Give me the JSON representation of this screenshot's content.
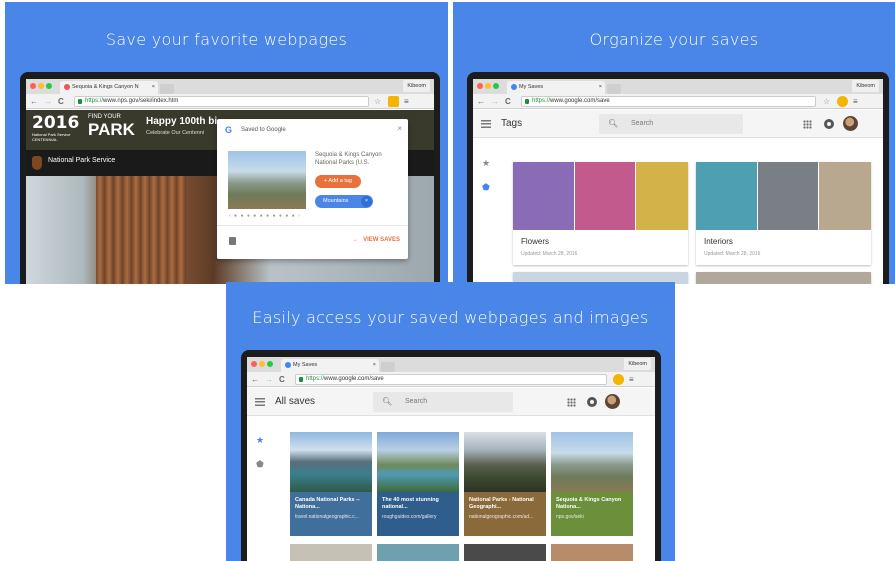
{
  "panels": {
    "p1": {
      "title": "Save your favorite webpages",
      "browser": {
        "tab_title": "Sequoia & Kings Canyon N",
        "tab_close": "×",
        "profile": "Kibeom",
        "url_scheme": "https://",
        "url_rest": "www.nps.gov/seki/index.htm"
      },
      "site": {
        "year": "2016",
        "logo_line1": "National Park Service",
        "logo_line2": "CENTENNIAL",
        "find_your": "FIND YOUR",
        "park": "PARK",
        "happy": "Happy 100th bi",
        "celebrate": "Celebrate Our Centenni",
        "bar_label": "National Park Service"
      },
      "popup": {
        "g_letter": "G",
        "saved_to": "Saved to Google",
        "close": "×",
        "page_title": "Sequoia & Kings Canyon National Parks (U.S.",
        "add_tag": "+ Add a tag",
        "tag": "Mountains",
        "tag_remove": "×",
        "pager": "‹ ● ● ● ● ● ● ● ● ● ● ›",
        "view_saves": "VIEW SAVES",
        "view_arrow": "→"
      }
    },
    "p2": {
      "title": "Organize your saves",
      "browser": {
        "tab_title": "My Saves",
        "tab_close": "×",
        "profile": "Kibeom",
        "url_scheme": "https://",
        "url_rest": "www.google.com/save"
      },
      "header": {
        "title": "Tags",
        "search_placeholder": "Search"
      },
      "cards": [
        {
          "name": "Flowers",
          "date": "Updated: March 28, 2016"
        },
        {
          "name": "Interiors",
          "date": "Updated: March 28, 2016"
        }
      ]
    },
    "p3": {
      "title": "Easily access your saved webpages and images",
      "browser": {
        "tab_title": "My Saves",
        "tab_close": "×",
        "profile": "Kibeom",
        "url_scheme": "https://",
        "url_rest": "www.google.com/save"
      },
      "header": {
        "title": "All saves",
        "search_placeholder": "Search"
      },
      "tiles": [
        {
          "title": "Canada National Parks -- Nationa...",
          "url": "travel.nationalgeographic.c...",
          "color": "#3f6f9a"
        },
        {
          "title": "The 40 most stunning national...",
          "url": "roughguides.com/gallery",
          "color": "#2f5e8c"
        },
        {
          "title": "National Parks - National Geographi...",
          "url": "nationalgeographic.com/ad...",
          "color": "#8a6a3a"
        },
        {
          "title": "Sequoia & Kings Canyon Nationa...",
          "url": "nps.gov/seki",
          "color": "#6b8f3a"
        }
      ]
    }
  },
  "icons": {
    "back": "←",
    "forward": "→",
    "reload": "C",
    "star": "☆",
    "menu": "≡",
    "search": "🔍︎",
    "sidebar_star": "★",
    "sidebar_tag": "⬟"
  },
  "colors": {
    "panel_bg": "#4a86e8",
    "accent_orange": "#e8713c",
    "tag_blue": "#4a86e8"
  }
}
